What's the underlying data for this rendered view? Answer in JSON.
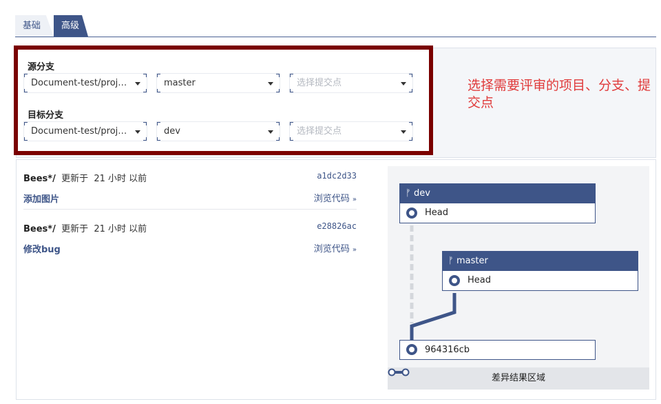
{
  "tabs": [
    {
      "label": "基础",
      "active": false
    },
    {
      "label": "高级",
      "active": true
    }
  ],
  "source": {
    "label": "源分支",
    "project": "Document-test/project...",
    "branch": "master",
    "commit_placeholder": "选择提交点"
  },
  "target": {
    "label": "目标分支",
    "project": "Document-test/project...",
    "branch": "dev",
    "commit_placeholder": "选择提交点"
  },
  "annotation": "选择需要评审的项目、分支、提交点",
  "commits": [
    {
      "author": "Bees*/",
      "updated": "更新于",
      "time": "21 小时 以前",
      "hash": "a1dc2d33",
      "message": "添加图片",
      "browse": "浏览代码"
    },
    {
      "author": "Bees*/",
      "updated": "更新于",
      "time": "21 小时 以前",
      "hash": "e28826ac",
      "message": "修改bug",
      "browse": "浏览代码"
    }
  ],
  "graph": {
    "dev": {
      "name": "dev",
      "head": "Head"
    },
    "master": {
      "name": "master",
      "head": "Head"
    },
    "base_commit": "964316cb",
    "footer": "差异结果区域"
  },
  "colors": {
    "accent": "#3e5588",
    "highlight_border": "#7a0000",
    "annotation": "#e03a3a"
  }
}
